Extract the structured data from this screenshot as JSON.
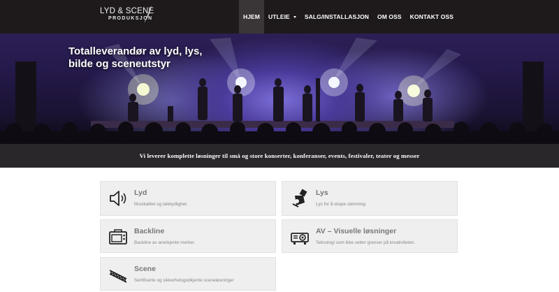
{
  "header": {
    "logo_line1": "LYD & SCENE",
    "logo_line2": "PRODUKSJON",
    "nav": [
      {
        "label": "HJEM",
        "active": true
      },
      {
        "label": "UTLEIE",
        "dropdown": true
      },
      {
        "label": "SALG/INSTALLASJON"
      },
      {
        "label": "OM OSS"
      },
      {
        "label": "KONTAKT OSS"
      }
    ]
  },
  "hero": {
    "title": "Totalleverandør av lyd, lys, bilde og sceneutstyr"
  },
  "banner": {
    "text": "Vi leverer komplette løsninger til små og store konserter, konferanser, events, festivaler, teater og messer"
  },
  "services": [
    {
      "title": "Lyd",
      "description": "Musikalitet og taletydlighet.",
      "icon": "speaker-icon"
    },
    {
      "title": "Lys",
      "description": "Lys for å skape stemning.",
      "icon": "spotlight-icon"
    },
    {
      "title": "Backline",
      "description": "Backline av anerkjente merker.",
      "icon": "amplifier-icon"
    },
    {
      "title": "AV – Visuelle løsninger",
      "description": "Teknologi som ikke setter grenser på kreativiteten.",
      "icon": "projector-icon"
    },
    {
      "title": "Scene",
      "description": "Sertifiserte og sikkerhetsgodkjente sceneløsninger",
      "icon": "truss-icon"
    }
  ],
  "colors": {
    "header_bg": "#1e1a1c",
    "banner_bg": "#292729",
    "card_bg": "#efefef",
    "card_title": "#777777"
  }
}
